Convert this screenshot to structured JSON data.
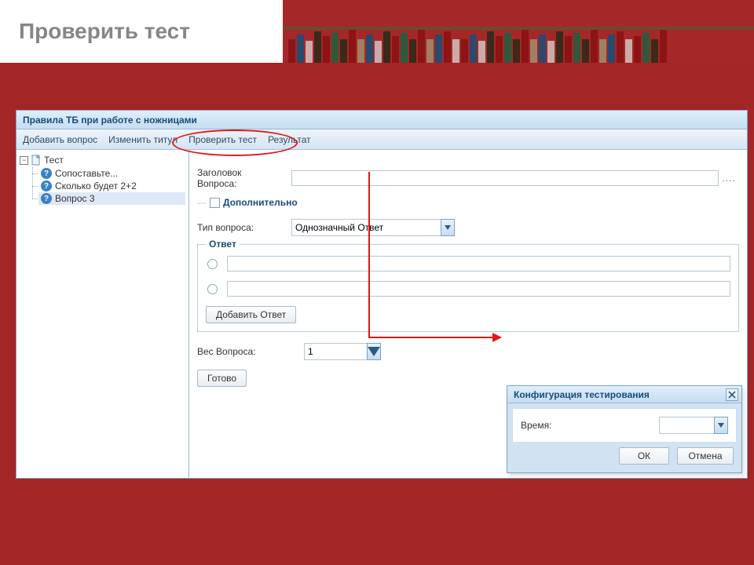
{
  "page": {
    "title": "Проверить тест"
  },
  "window": {
    "title": "Правила ТБ при работе с ножницами"
  },
  "toolbar": {
    "items": [
      "Добавить вопрос",
      "Изменить титул",
      "Проверить тест",
      "Результат"
    ]
  },
  "tree": {
    "root": "Тест",
    "items": [
      "Сопоставьте...",
      "Сколько будет 2+2",
      "Вопрос 3"
    ],
    "selected_index": 2
  },
  "form": {
    "title_label_line1": "Заголовок",
    "title_label_line2": "Вопроса:",
    "title_value": "",
    "ellipsis": "....",
    "additional_label": "Дополнительно",
    "type_label": "Тип вопроса:",
    "type_value": "Однозначный Ответ",
    "answer_legend": "Ответ",
    "answers": [
      "",
      ""
    ],
    "add_answer_btn": "Добавить Ответ",
    "weight_label": "Вес Вопроса:",
    "weight_value": "1",
    "done_btn": "Готово"
  },
  "dialog": {
    "title": "Конфигурация тестирования",
    "time_label": "Время:",
    "time_value": "",
    "ok": "ОК",
    "cancel": "Отмена"
  }
}
